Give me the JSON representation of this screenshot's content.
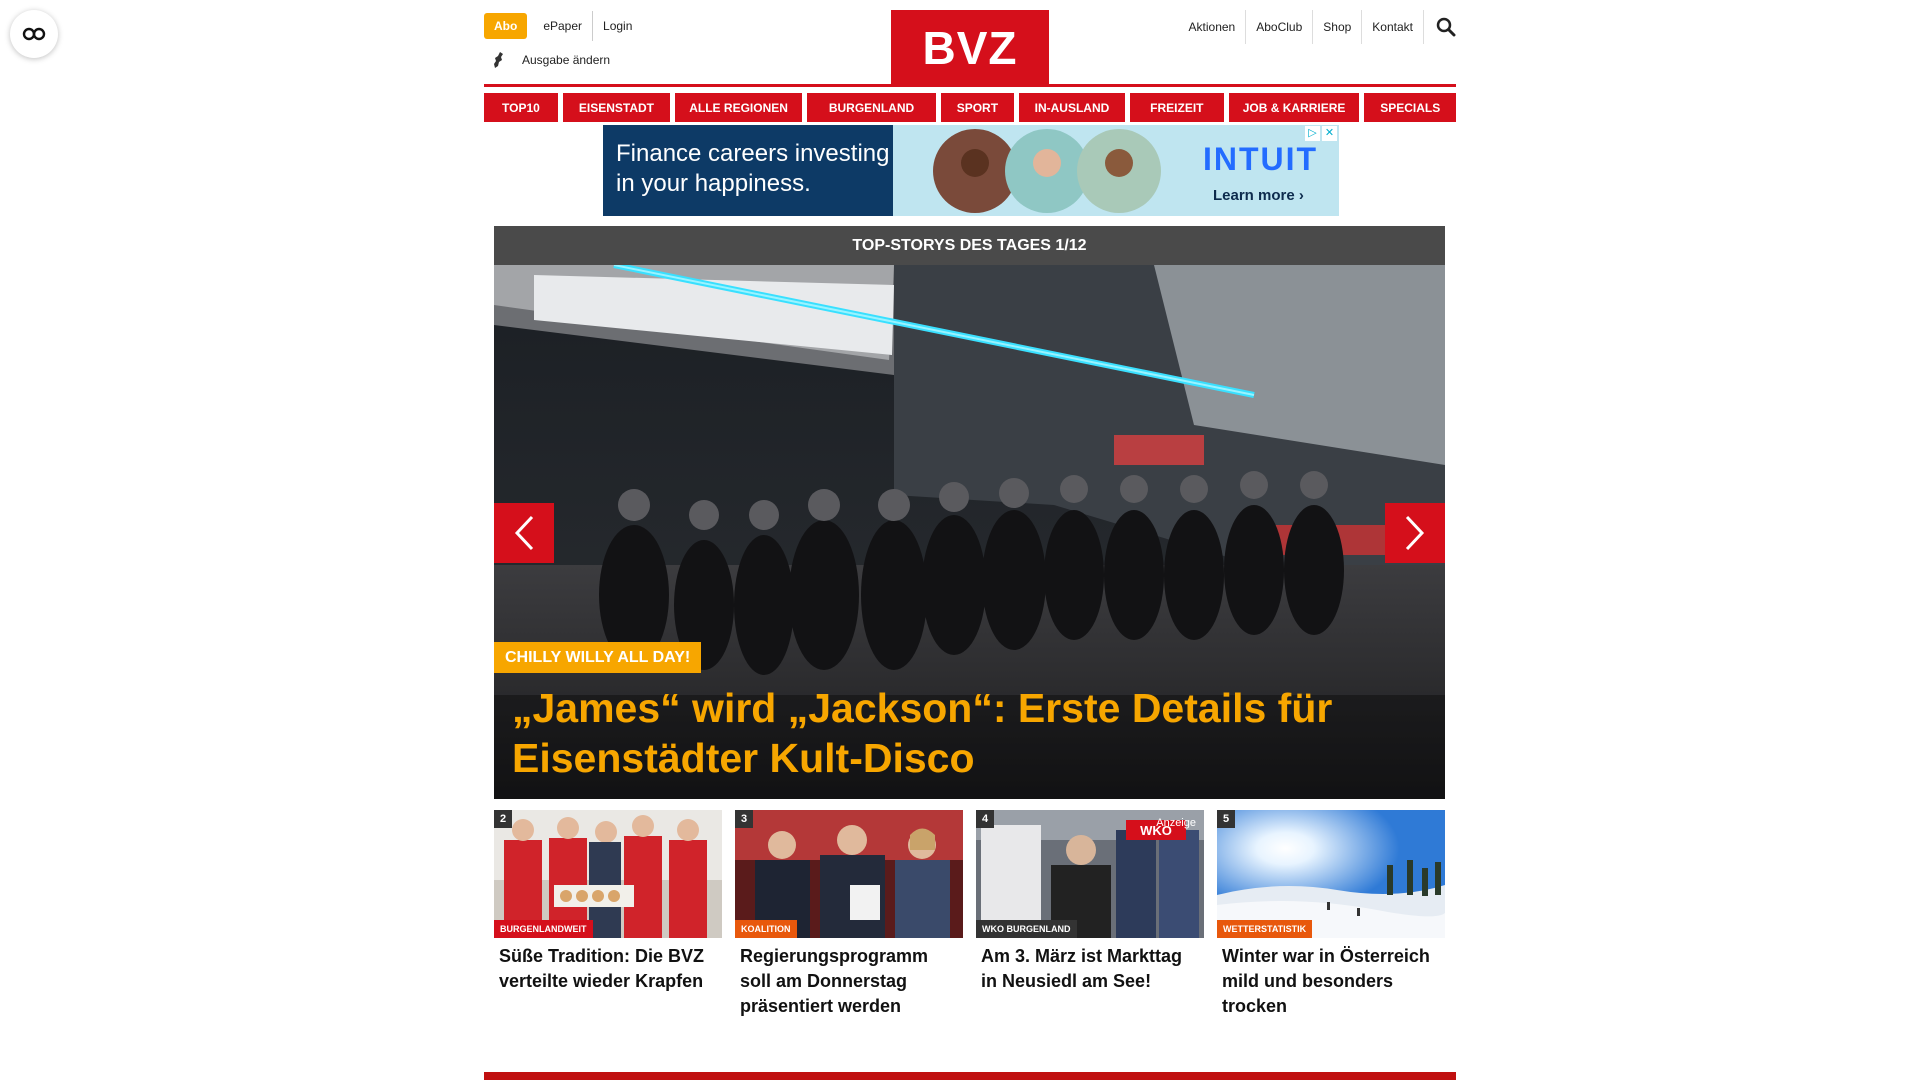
{
  "header": {
    "abo": "Abo",
    "links_left": [
      "ePaper",
      "Login"
    ],
    "edition": "Ausgabe ändern",
    "logo": "BVZ",
    "links_right": [
      "Aktionen",
      "AboClub",
      "Shop",
      "Kontakt"
    ]
  },
  "nav": [
    {
      "label": "TOP10"
    },
    {
      "label": "EISENSTADT"
    },
    {
      "label": "ALLE REGIONEN"
    },
    {
      "label": "BURGENLAND"
    },
    {
      "label": "SPORT"
    },
    {
      "label": "IN-AUSLAND"
    },
    {
      "label": "FREIZEIT"
    },
    {
      "label": "JOB & KARRIERE"
    },
    {
      "label": "SPECIALS"
    }
  ],
  "ad": {
    "line1": "Finance careers investing",
    "line2": "in your happiness.",
    "brand": "INTUIT",
    "cta": "Learn more ›"
  },
  "stories": {
    "heading": "TOP-STORYS DES TAGES 1/12",
    "hero": {
      "kicker": "CHILLY WILLY ALL DAY!",
      "title": "„James“ wird „Jackson“: Erste Details für Eisenstädter Kult-Disco"
    }
  },
  "teasers": [
    {
      "num": "2",
      "category": "BURGENLANDWEIT",
      "title": "Süße Tradition: Die BVZ verteilte wieder Krapfen"
    },
    {
      "num": "3",
      "category": "KOALITION",
      "title": "Regierungsprogramm soll am Donnerstag präsentiert werden"
    },
    {
      "num": "4",
      "category": "WKO BURGENLAND",
      "title": "Am 3. März ist Markttag in Neusiedl am See!",
      "ad_label": "Anzeige"
    },
    {
      "num": "5",
      "category": "WETTERSTATISTIK",
      "title": "Winter war in Österreich mild und besonders trocken"
    }
  ]
}
